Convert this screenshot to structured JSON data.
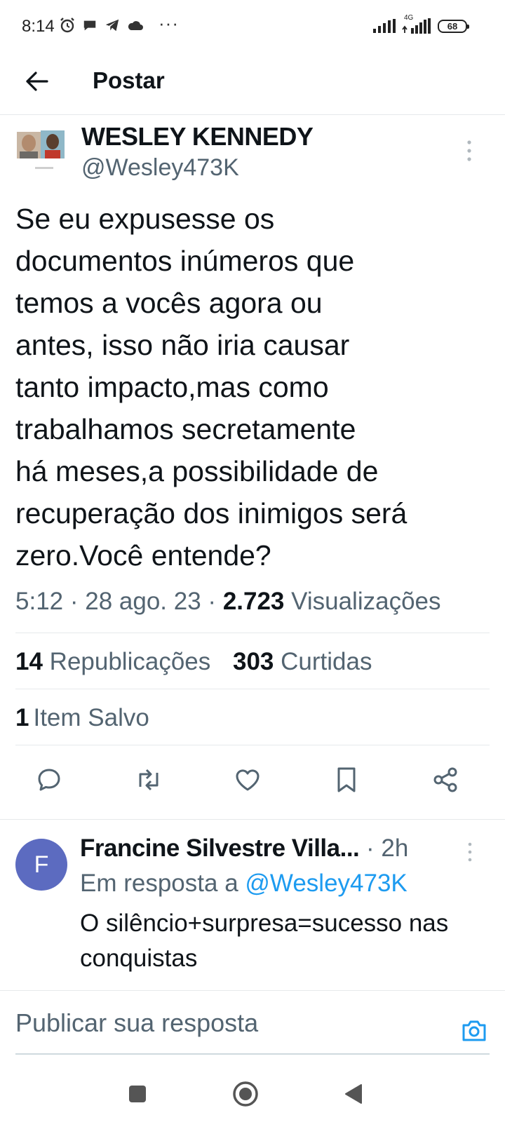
{
  "status_bar": {
    "time": "8:14",
    "network_type": "4G",
    "battery": "68"
  },
  "header": {
    "title": "Postar"
  },
  "post": {
    "author_name": "WESLEY KENNEDY",
    "author_handle": "@Wesley473K",
    "text": "Se eu expusesse os\ndocumentos inúmeros que\ntemos a vocês agora ou\nantes, isso não iria causar\ntanto impacto,mas como\ntrabalhamos secretamente\nhá meses,a possibilidade de\nrecuperação dos inimigos será\nzero.Você entende?",
    "time": "5:12",
    "date": "28 ago. 23",
    "views_count": "2.723",
    "views_label": "Visualizações",
    "reposts_count": "14",
    "reposts_label": "Republicações",
    "likes_count": "303",
    "likes_label": "Curtidas",
    "bookmarks_count": "1",
    "bookmarks_label": "Item Salvo"
  },
  "actions": [
    "reply-icon",
    "repost-icon",
    "like-icon",
    "bookmark-icon",
    "share-icon"
  ],
  "reply": {
    "avatar_letter": "F",
    "author_name": "Francine Silvestre Villa...",
    "time": "2h",
    "replying_to_label": "Em resposta a",
    "replying_to_handle": "@Wesley473K",
    "text": "O silêncio+surpresa=sucesso nas conquistas"
  },
  "composer": {
    "placeholder": "Publicar sua resposta"
  },
  "colors": {
    "accent": "#1d9bf0",
    "secondary_text": "#536471",
    "avatar_bg": "#5c6bc0"
  }
}
